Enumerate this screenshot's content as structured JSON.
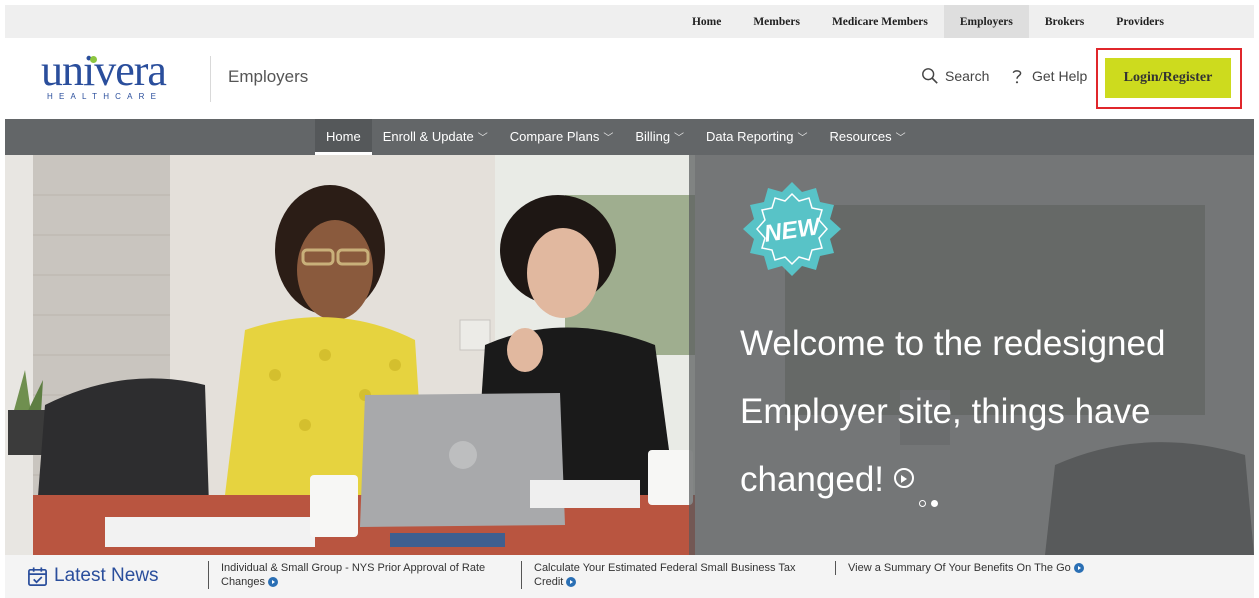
{
  "top_nav": {
    "links": [
      {
        "label": "Home",
        "active": false
      },
      {
        "label": "Members",
        "active": false
      },
      {
        "label": "Medicare Members",
        "active": false
      },
      {
        "label": "Employers",
        "active": true
      },
      {
        "label": "Brokers",
        "active": false
      },
      {
        "label": "Providers",
        "active": false
      }
    ]
  },
  "header": {
    "logo_word": "univera",
    "logo_sub": "HEALTHCARE",
    "section_title": "Employers",
    "search_label": "Search",
    "help_label": "Get Help",
    "login_label": "Login/Register"
  },
  "main_nav": {
    "items": [
      {
        "label": "Home",
        "dropdown": false,
        "active": true
      },
      {
        "label": "Enroll & Update",
        "dropdown": true,
        "active": false
      },
      {
        "label": "Compare Plans",
        "dropdown": true,
        "active": false
      },
      {
        "label": "Billing",
        "dropdown": true,
        "active": false
      },
      {
        "label": "Data Reporting",
        "dropdown": true,
        "active": false
      },
      {
        "label": "Resources",
        "dropdown": true,
        "active": false
      }
    ]
  },
  "hero": {
    "badge": "NEW",
    "headline_line1": "Welcome to the redesigned",
    "headline_line2": "Employer site, things have",
    "headline_line3": "changed!",
    "slides": 2,
    "active_slide": 2
  },
  "news": {
    "title": "Latest News",
    "items": [
      {
        "line1": "Individual & Small Group - NYS Prior Approval of Rate",
        "line2": "Changes"
      },
      {
        "line1": "Calculate Your Estimated Federal Small Business Tax",
        "line2": "Credit"
      },
      {
        "line1": "View a Summary Of Your Benefits On The Go",
        "line2": ""
      }
    ]
  },
  "colors": {
    "brand_blue": "#2a4e9c",
    "login_button": "#cddb1e",
    "nav_bar": "#636668",
    "highlight_outline": "#e0262b"
  }
}
